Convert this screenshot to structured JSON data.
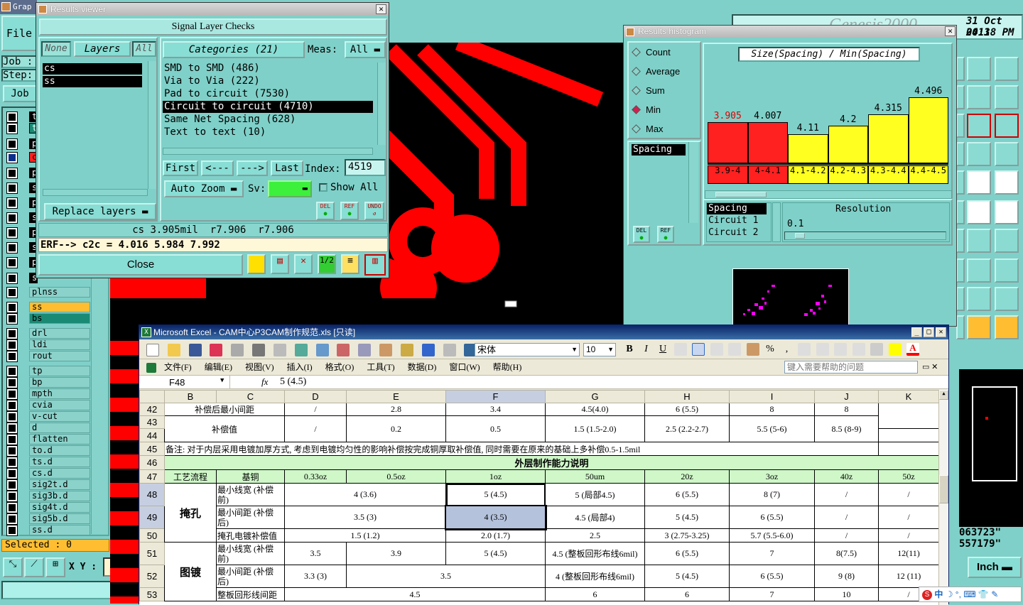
{
  "app": {
    "title_short": "Grap",
    "file_menu": "File",
    "clock_title": "Genesis2000",
    "date": "31 Oct 2013",
    "time": "04:18 PM",
    "job_label": "Job :",
    "step_label": "Step:",
    "job_button": "Job",
    "selected": "Selected : 0",
    "xy_label": "X Y :",
    "coord1": "063723\"",
    "coord2": "557179\"",
    "unit": "Inch"
  },
  "layers": [
    "t",
    "t",
    "p",
    "c",
    "p",
    "s",
    "p",
    "s",
    "p",
    "s",
    "p",
    "s",
    "sig5b",
    "plnss",
    "ss",
    "bs",
    "drl",
    "ldi",
    "rout",
    "tp",
    "bp",
    "mpth",
    "cvia",
    "v-cut",
    "d",
    "flatten",
    "to.d",
    "ts.d",
    "cs.d",
    "sig2t.d",
    "sig3b.d",
    "sig4t.d",
    "sig5b.d",
    "ss.d"
  ],
  "results_viewer": {
    "title": "Results viewer",
    "header": "Signal Layer Checks",
    "none": "None",
    "layers": "Layers",
    "all": "All",
    "categories": "Categories (21)",
    "meas_label": "Meas:",
    "meas_value": "All",
    "layer_items": [
      "cs",
      "ss"
    ],
    "category_items": [
      "SMD to SMD (486)",
      "Via to Via (222)",
      "Pad to circuit (7530)",
      "Circuit to circuit (4710)",
      "Same Net Spacing (628)",
      "Text to text (10)"
    ],
    "first": "First",
    "prev": "<---",
    "next": "--->",
    "last": "Last",
    "index_label": "Index:",
    "index_value": "4519",
    "auto_zoom": "Auto Zoom",
    "sv": "Sv:",
    "show_all": "Show All",
    "replace_layers": "Replace layers",
    "del": "DEL",
    "ref": "REF",
    "undo": "UNDO",
    "status1": "cs 3.905mil  r7.906  r7.906",
    "status2": "ERF--> c2c = 4.016 5.984 7.992",
    "close": "Close"
  },
  "histogram": {
    "title": "Results histogram",
    "options": [
      "Count",
      "Average",
      "Sum",
      "Min",
      "Max"
    ],
    "selected_option": "Min",
    "chart_title": "Size(Spacing) / Min(Spacing)",
    "spacing_item": "Spacing",
    "list2": [
      "Spacing",
      "Circuit 1",
      "Circuit 2"
    ],
    "resolution_label": "Resolution",
    "resolution_value": "0.1",
    "del": "DEL",
    "ref": "REF"
  },
  "chart_data": {
    "type": "bar",
    "title": "Size(Spacing) / Min(Spacing)",
    "categories": [
      "3.9-4",
      "4-4.1",
      "4.1-4.2",
      "4.2-4.3",
      "4.3-4.4",
      "4.4-4.5"
    ],
    "values": [
      3.905,
      4.007,
      4.11,
      4.2,
      4.315,
      4.496
    ],
    "colors": [
      "#ff2020",
      "#ff2020",
      "#ffff20",
      "#ffff20",
      "#ffff20",
      "#ffff20"
    ]
  },
  "excel": {
    "title": "Microsoft Excel - CAM中心P3CAM制作规范.xls [只读]",
    "menu": [
      "文件(F)",
      "编辑(E)",
      "视图(V)",
      "插入(I)",
      "格式(O)",
      "工具(T)",
      "数据(D)",
      "窗口(W)",
      "帮助(H)"
    ],
    "help_placeholder": "键入需要帮助的问题",
    "font": "宋体",
    "size": "10",
    "namebox": "F48",
    "formula": "5 (4.5)",
    "fx": "fx",
    "columns": [
      "B",
      "C",
      "D",
      "E",
      "F",
      "G",
      "H",
      "I",
      "J",
      "K"
    ],
    "rows": {
      "r42": {
        "num": "42",
        "label": "补偿后最小间距",
        "d": "/",
        "e": "2.8",
        "f": "3.4",
        "g": "4.5(4.0)",
        "h": "6 (5.5)",
        "i": "8",
        "j": "8"
      },
      "r43": {
        "num": "43"
      },
      "r44": {
        "num": "44",
        "label": "补偿值",
        "d": "/",
        "e": "0.2",
        "f": "0.5",
        "g": "1.5 (1.5-2.0)",
        "h": "2.5 (2.2-2.7)",
        "i": "5.5 (5-6)",
        "j": "8.5 (8-9)"
      },
      "r45": {
        "num": "45",
        "note": "备注: 对于内层采用电镀加厚方式, 考虑到电镀均匀性的影响补偿按完成铜厚取补偿值, 同时需要在原来的基础上多补偿0.5-1.5mil"
      },
      "r46": {
        "num": "46",
        "heading": "外层制作能力说明"
      },
      "r47": {
        "num": "47",
        "b": "工艺流程",
        "c": "基铜",
        "d": "0.33oz",
        "e": "0.5oz",
        "f": "1oz",
        "g": "50um",
        "h": "20z",
        "i": "3oz",
        "j": "40z",
        "k": "50z"
      },
      "r48": {
        "num": "48",
        "group": "掩孔",
        "c": "最小线宽 (补偿前)",
        "de": "4 (3.6)",
        "f": "5 (4.5)",
        "g": "5 (局部4.5)",
        "h": "6 (5.5)",
        "i": "8 (7)",
        "j": "/",
        "k": "/"
      },
      "r49": {
        "num": "49",
        "c": "最小间距 (补偿后)",
        "de": "3.5 (3)",
        "f": "4 (3.5)",
        "g": "4.5 (局部4)",
        "h": "5 (4.5)",
        "i": "6 (5.5)",
        "j": "/",
        "k": "/"
      },
      "r50": {
        "num": "50",
        "c": "掩孔电镀补偿值",
        "de": "1.5 (1.2)",
        "f": "2.0 (1.7)",
        "g": "2.5",
        "h": "3 (2.75-3.25)",
        "i": "5.7 (5.5-6.0)",
        "j": "/",
        "k": "/"
      },
      "r51": {
        "num": "51",
        "group": "图镀",
        "c": "最小线宽 (补偿前)",
        "d": "3.5",
        "e": "3.9",
        "f": "5 (4.5)",
        "g": "4.5 (整板回形布线6mil)",
        "h": "6 (5.5)",
        "i": "7",
        "j": "8(7.5)",
        "k": "12(11)"
      },
      "r52": {
        "num": "52",
        "c": "最小间距 (补偿后)",
        "d": "3.3 (3)",
        "ef": "3.5",
        "g": "4 (整板回形布线6mil)",
        "h": "5 (4.5)",
        "i": "6 (5.5)",
        "j": "9 (8)",
        "k": "12 (11)"
      },
      "r53": {
        "num": "53",
        "c": "整板回形线间距",
        "def": "4.5",
        "g": "6",
        "h": "6",
        "i": "7",
        "j": "10",
        "k": "/"
      }
    }
  },
  "tray": {
    "ime": "中"
  }
}
